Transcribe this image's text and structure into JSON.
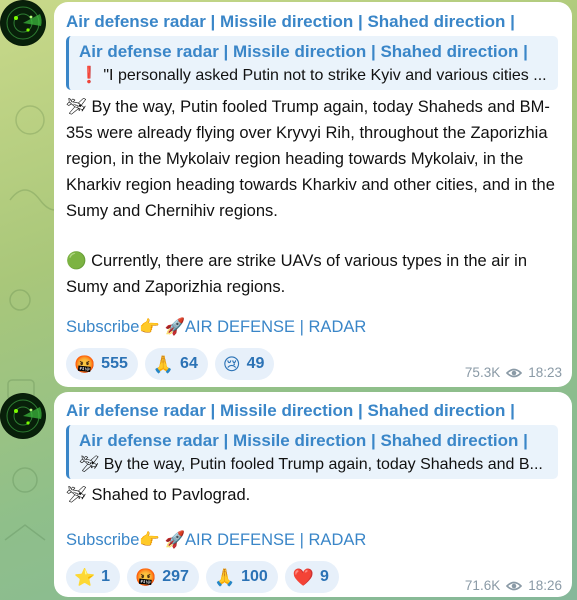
{
  "posts": [
    {
      "channel": "Air defense radar | Missile direction | Shahed direction |",
      "quote_title": "Air defense radar | Missile direction | Shahed direction |",
      "quote_text": "❗ \"I personally asked Putin not to strike Kyiv and various cities ...",
      "body_line1": "🛩 By the way, Putin fooled Trump again, today Shaheds and BM-35s were already flying over Kryvyi Rih, throughout the Zaporizhia region, in the Mykolaiv region heading towards Mykolaiv, in the Kharkiv region heading towards Kharkiv and other cities, and in the Sumy and Chernihiv regions.",
      "body_line2": "🟢 Currently, there are strike UAVs of various types in the air in Sumy and Zaporizhia regions.",
      "subscribe": "Subscribe👉 🚀AIR DEFENSE | RADAR",
      "reactions": [
        {
          "emoji": "🤬",
          "count": "555"
        },
        {
          "emoji": "🙏",
          "count": "64"
        },
        {
          "emoji": "😢",
          "count": "49"
        }
      ],
      "views": "75.3K",
      "time": "18:23"
    },
    {
      "channel": "Air defense radar | Missile direction | Shahed direction |",
      "quote_title": "Air defense radar | Missile direction | Shahed direction |",
      "quote_text": "🛩 By the way, Putin fooled Trump again, today Shaheds and B...",
      "body_line1": "🛩 Shahed to Pavlograd.",
      "subscribe": "Subscribe👉 🚀AIR DEFENSE | RADAR",
      "reactions": [
        {
          "emoji": "⭐",
          "count": "1"
        },
        {
          "emoji": "🤬",
          "count": "297"
        },
        {
          "emoji": "🙏",
          "count": "100"
        },
        {
          "emoji": "❤️",
          "count": "9"
        }
      ],
      "views": "71.6K",
      "time": "18:26"
    }
  ],
  "colors": {
    "accent": "#3a86c8",
    "chip_bg": "#e7f0fa",
    "meta": "#8a9aa6"
  },
  "icons": {
    "avatar": "radar-avatar-icon",
    "views": "eye-icon"
  }
}
